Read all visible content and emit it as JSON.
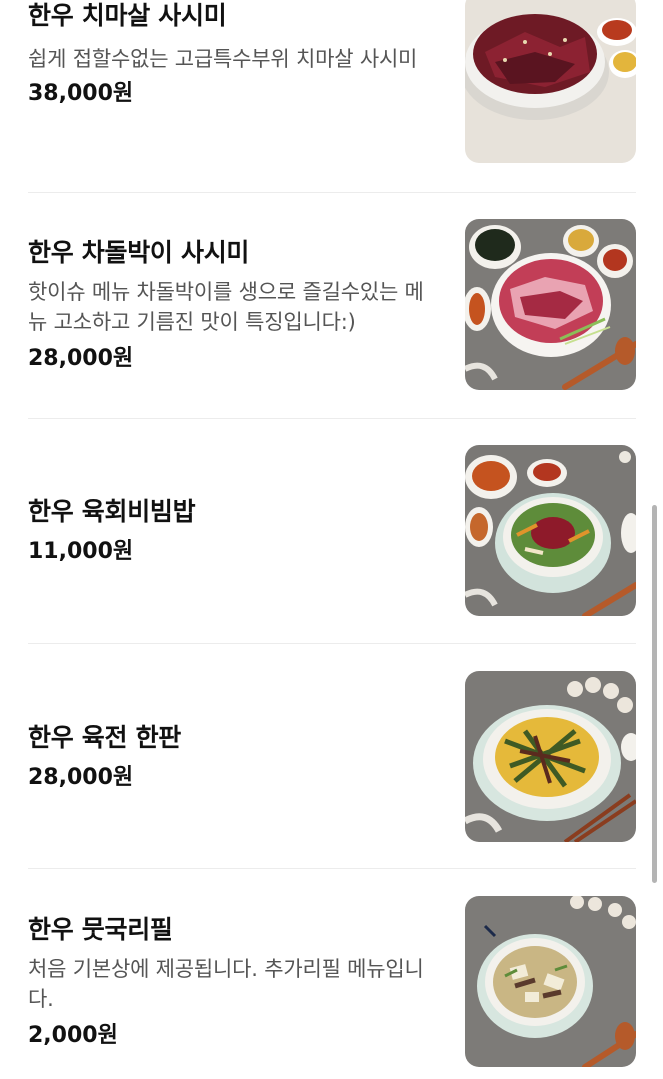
{
  "menu": {
    "items": [
      {
        "name": "한우 치마살 사시미",
        "description": "쉽게 접할수없는 고급특수부위 치마살 사시미",
        "price": "38,000원",
        "image": "sliced-raw-beef-plate"
      },
      {
        "name": "한우 차돌박이 사시미",
        "description": "핫이슈 메뉴 차돌박이를 생으로 즐길수있는 메뉴 고소하고 기름진 맛이 특징입니다:)",
        "price": "28,000원",
        "image": "raw-brisket-plate"
      },
      {
        "name": "한우 육회비빔밥",
        "description": "",
        "price": "11,000원",
        "image": "yukhoe-bibimbap-bowl"
      },
      {
        "name": "한우 육전 한판",
        "description": "",
        "price": "28,000원",
        "image": "beef-jeon-pancake-plate"
      },
      {
        "name": "한우 뭇국리필",
        "description": "처음 기본상에 제공됩니다. 추가리필 메뉴입니다.",
        "price": "2,000원",
        "image": "radish-soup-bowl"
      }
    ]
  },
  "colors": {
    "accent_text": "#111111",
    "muted_text": "#555555",
    "divider": "#ececec"
  }
}
